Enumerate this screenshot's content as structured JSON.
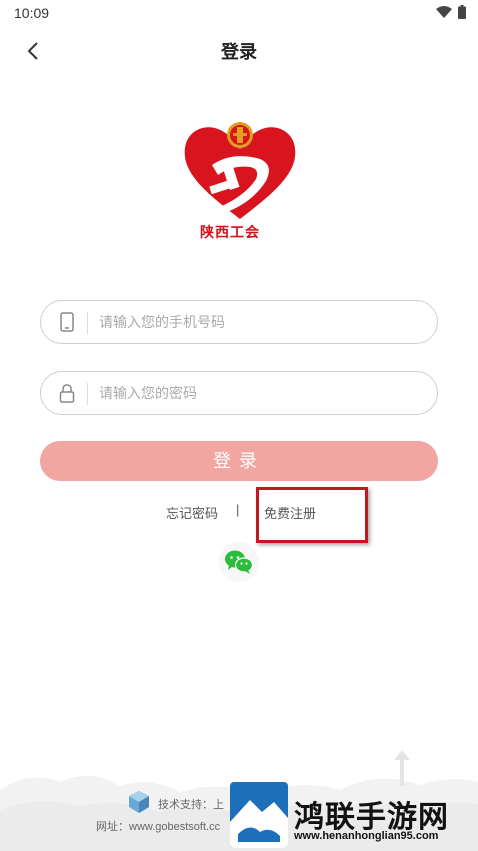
{
  "status_bar": {
    "time": "10:09",
    "icons": [
      "wifi-icon",
      "battery-icon"
    ]
  },
  "nav": {
    "title": "登录",
    "back_icon": "chevron-left-icon"
  },
  "logo": {
    "caption": "陕西工会"
  },
  "form": {
    "phone_placeholder": "请输入您的手机号码",
    "phone_value": "",
    "password_placeholder": "请输入您的密码",
    "password_value": "",
    "login_label": "登录"
  },
  "links": {
    "forgot": "忘记密码",
    "separator": "|",
    "register": "免费注册"
  },
  "social": {
    "wechat_icon": "wechat-icon"
  },
  "footer": {
    "support": "技术支持：上",
    "website": "网址：www.gobestsoft.cc"
  },
  "watermark": {
    "title": "鸿联手游网",
    "url": "www.henanhonglian95.com"
  },
  "colors": {
    "brand_red": "#d0121b",
    "login_button": "#f2a6a2",
    "highlight": "#c0191f"
  }
}
